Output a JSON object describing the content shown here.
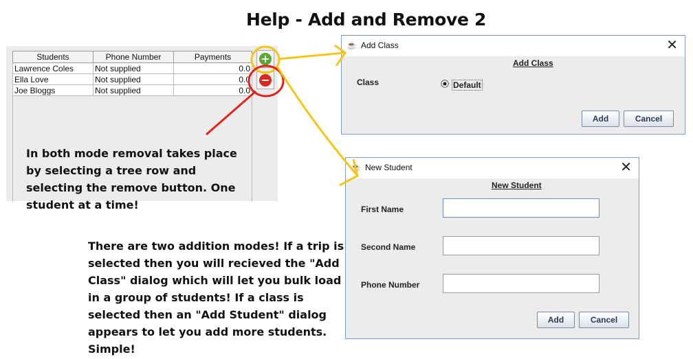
{
  "page_title": "Help - Add and Remove 2",
  "table": {
    "columns": [
      "Students",
      "Phone Number",
      "Payments"
    ],
    "rows": [
      [
        "Lawrence Coles",
        "Not supplied",
        "0.0"
      ],
      [
        "Ella Love",
        "Not supplied",
        "0.0"
      ],
      [
        "Joe Bloggs",
        "Not supplied",
        "0.0"
      ]
    ]
  },
  "buttons": {
    "add_icon": "plus-icon",
    "remove_icon": "minus-icon"
  },
  "notes": {
    "removal": "In both mode removal takes place by selecting a tree row and selecting the remove button. One student at a time!",
    "addition": "There are two addition modes! If a trip is selected then you will recieved the \"Add Class\" dialog which will let you bulk load in a group of students! If a class is selected then an \"Add Student\" dialog appears to let you add more students. Simple!"
  },
  "add_class_dialog": {
    "window_title": "Add Class",
    "heading": "Add Class",
    "class_label": "Class",
    "radio_option": "Default",
    "add_label": "Add",
    "cancel_label": "Cancel"
  },
  "new_student_dialog": {
    "window_title": "New Student",
    "heading": "New Student",
    "first_name_label": "First Name",
    "second_name_label": "Second Name",
    "phone_label": "Phone Number",
    "first_name_value": "",
    "second_name_value": "",
    "phone_value": "",
    "add_label": "Add",
    "cancel_label": "Cancel"
  },
  "colors": {
    "annotation_yellow": "#f5c518",
    "annotation_red": "#e2231a",
    "add_green": "#5aa832",
    "remove_red": "#d9281f"
  }
}
